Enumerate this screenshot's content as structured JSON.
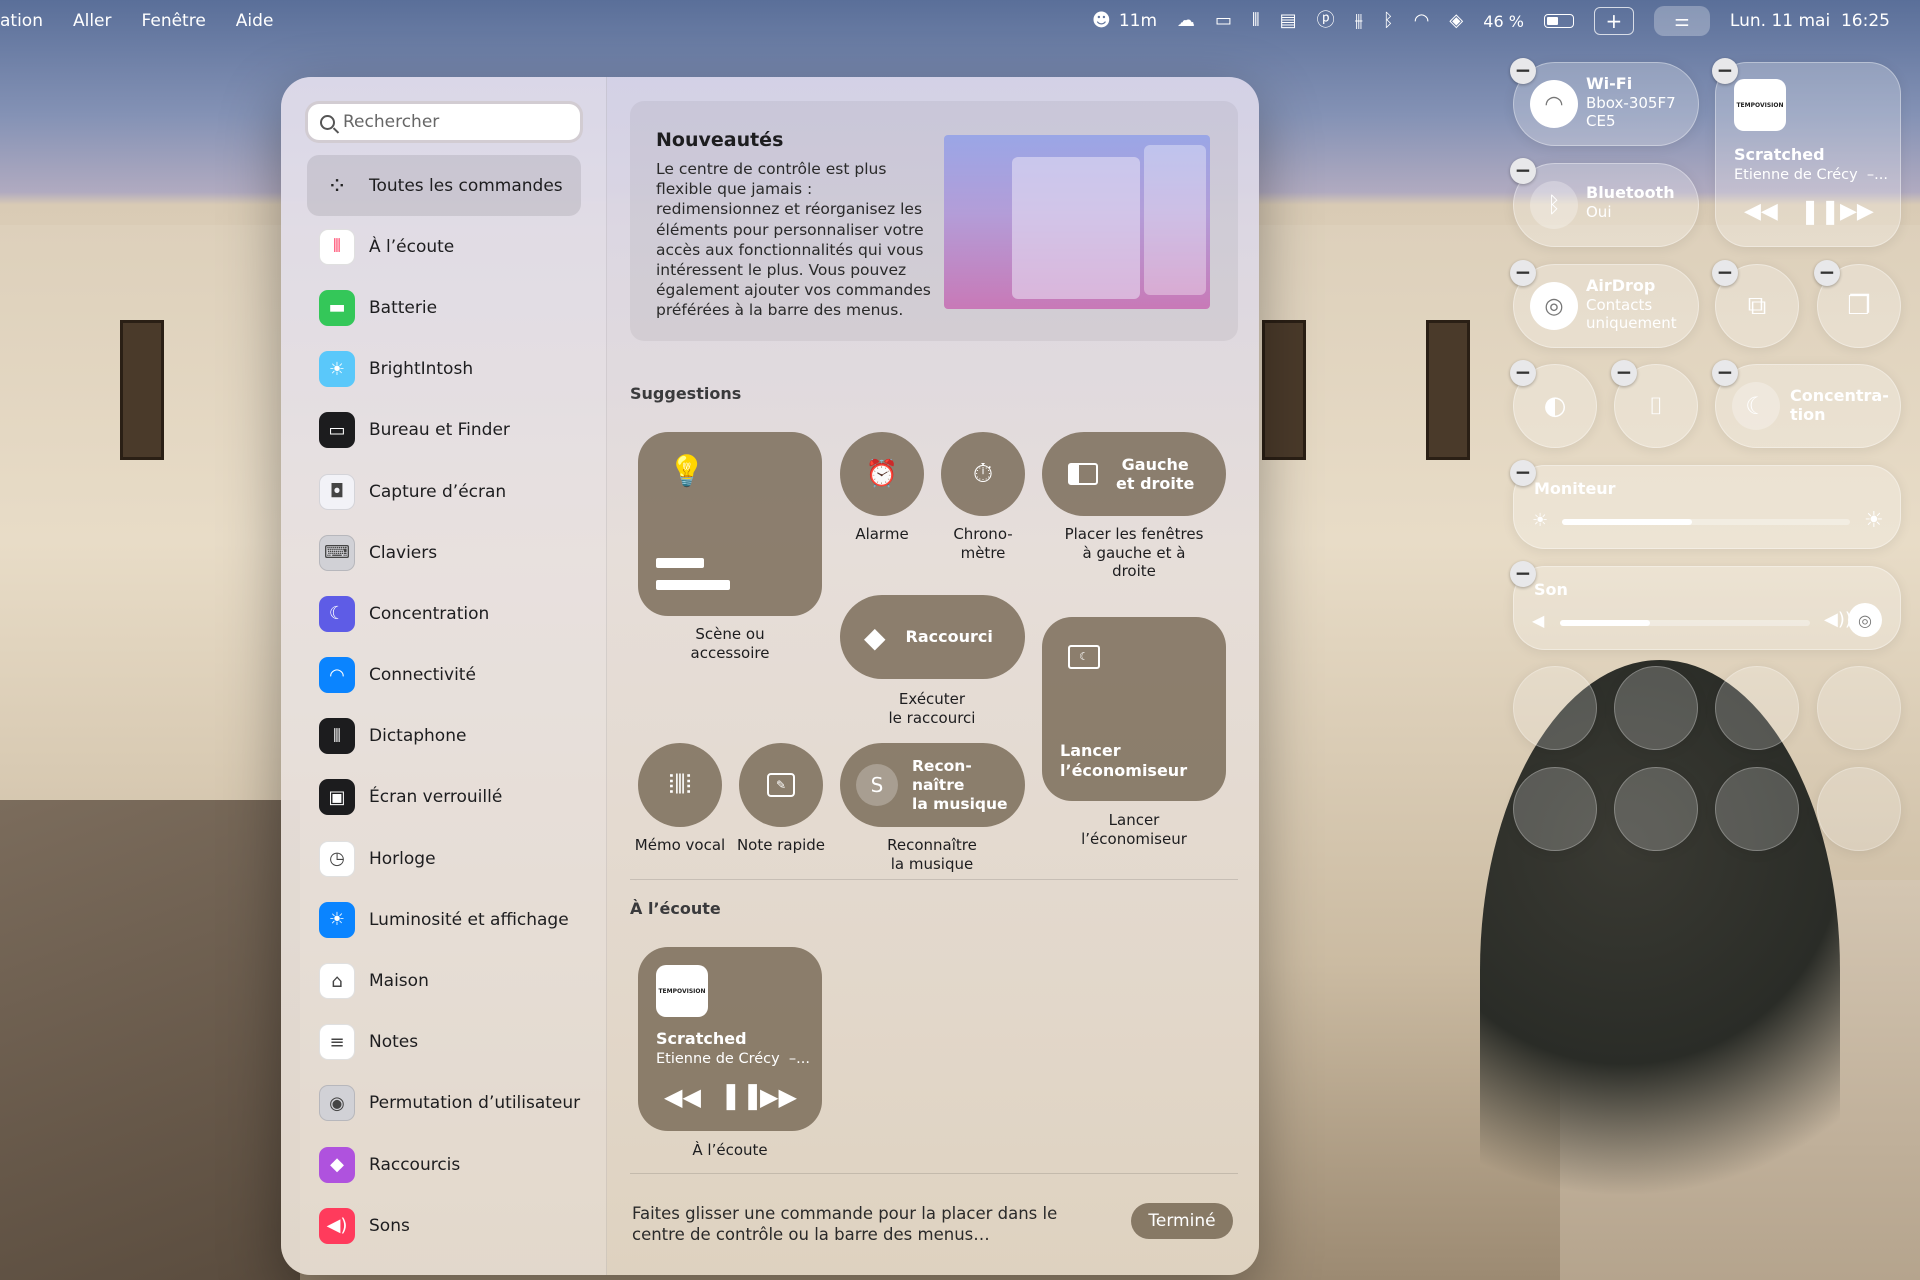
{
  "menubar": {
    "app_fragment": "ation",
    "menus": [
      "Aller",
      "Fenêtre",
      "Aide"
    ],
    "timer": "11m",
    "battery_percent": "46 %",
    "battery_level": 0.46,
    "date_time": "Lun. 11 mai  16:25"
  },
  "search": {
    "placeholder": "Rechercher"
  },
  "sidebar": {
    "items": [
      {
        "label": "Toutes les commandes",
        "icon": "grid-icon",
        "color": "#ffffff"
      },
      {
        "label": "À l’écoute",
        "icon": "waveform-icon",
        "color": "#ffffff"
      },
      {
        "label": "Batterie",
        "icon": "battery-icon",
        "color": "#34c759"
      },
      {
        "label": "BrightIntosh",
        "icon": "sun-icon",
        "color": "#5ac8fa"
      },
      {
        "label": "Bureau et Finder",
        "icon": "desktop-icon",
        "color": "#1c1c1e"
      },
      {
        "label": "Capture d’écran",
        "icon": "camera-icon",
        "color": "#f2f2f7"
      },
      {
        "label": "Claviers",
        "icon": "keyboard-icon",
        "color": "#d1d1d6"
      },
      {
        "label": "Concentration",
        "icon": "moon-icon",
        "color": "#5e5ce6"
      },
      {
        "label": "Connectivité",
        "icon": "wifi-icon",
        "color": "#0a84ff"
      },
      {
        "label": "Dictaphone",
        "icon": "voice-memo-icon",
        "color": "#1c1c1e"
      },
      {
        "label": "Écran verrouillé",
        "icon": "lock-icon",
        "color": "#1c1c1e"
      },
      {
        "label": "Horloge",
        "icon": "clock-icon",
        "color": "#ffffff"
      },
      {
        "label": "Luminosité et affichage",
        "icon": "brightness-icon",
        "color": "#0a84ff"
      },
      {
        "label": "Maison",
        "icon": "home-icon",
        "color": "#ffffff"
      },
      {
        "label": "Notes",
        "icon": "notes-icon",
        "color": "#ffffff"
      },
      {
        "label": "Permutation d’utilisateur",
        "icon": "user-icon",
        "color": "#d1d1d6"
      },
      {
        "label": "Raccourcis",
        "icon": "shortcuts-icon",
        "color": "#af52de"
      },
      {
        "label": "Sons",
        "icon": "speaker-icon",
        "color": "#ff3b5c"
      }
    ]
  },
  "whatsnew": {
    "title": "Nouveautés",
    "body": "Le centre de contrôle est plus flexible que jamais : redimensionnez et réorganisez les éléments pour personnaliser votre accès aux fonctionnalités qui vous intéressent le plus. Vous pouvez également ajouter vos commandes préférées à la barre des menus."
  },
  "suggestions": {
    "title": "Suggestions",
    "scene_caption": "Scène ou\naccessoire",
    "alarm_caption": "Alarme",
    "chrono_caption": "Chrono-\nmètre",
    "left_right_label": "Gauche\net droite",
    "left_right_caption": "Placer les fenêtres\nà gauche et à\ndroite",
    "shortcut_label": "Raccourci",
    "shortcut_caption": "Exécuter\nle raccourci",
    "saver_label": "Lancer\nl’économiseur",
    "saver_caption": "Lancer\nl’économiseur",
    "memo_caption": "Mémo vocal",
    "quicknote_caption": "Note rapide",
    "recognize_label": "Recon-\nnaître\nla musique",
    "recognize_caption": "Reconnaître\nla musique"
  },
  "listening": {
    "title": "À l’écoute",
    "track": "Scratched",
    "artist": "Etienne de Crécy  –...",
    "caption": "À l’écoute",
    "art_text": "TEMPOVISION"
  },
  "footer": {
    "text": "Faites glisser une commande pour la placer dans le centre de contrôle ou la barre des menus…",
    "done": "Terminé"
  },
  "control_center": {
    "wifi": {
      "title": "Wi-Fi",
      "value": "Bbox-305F7\nCE5"
    },
    "bluetooth": {
      "title": "Bluetooth",
      "value": "Oui"
    },
    "airdrop": {
      "title": "AirDrop",
      "value": "Contacts\nuniquement"
    },
    "now_playing": {
      "track": "Scratched",
      "artist": "Etienne de Crécy  –...",
      "art_text": "TEMPOVISION"
    },
    "focus": {
      "title": "Concentra-\ntion"
    },
    "display": {
      "title": "Moniteur",
      "level": 0.45
    },
    "sound": {
      "title": "Son",
      "level": 0.36
    }
  }
}
